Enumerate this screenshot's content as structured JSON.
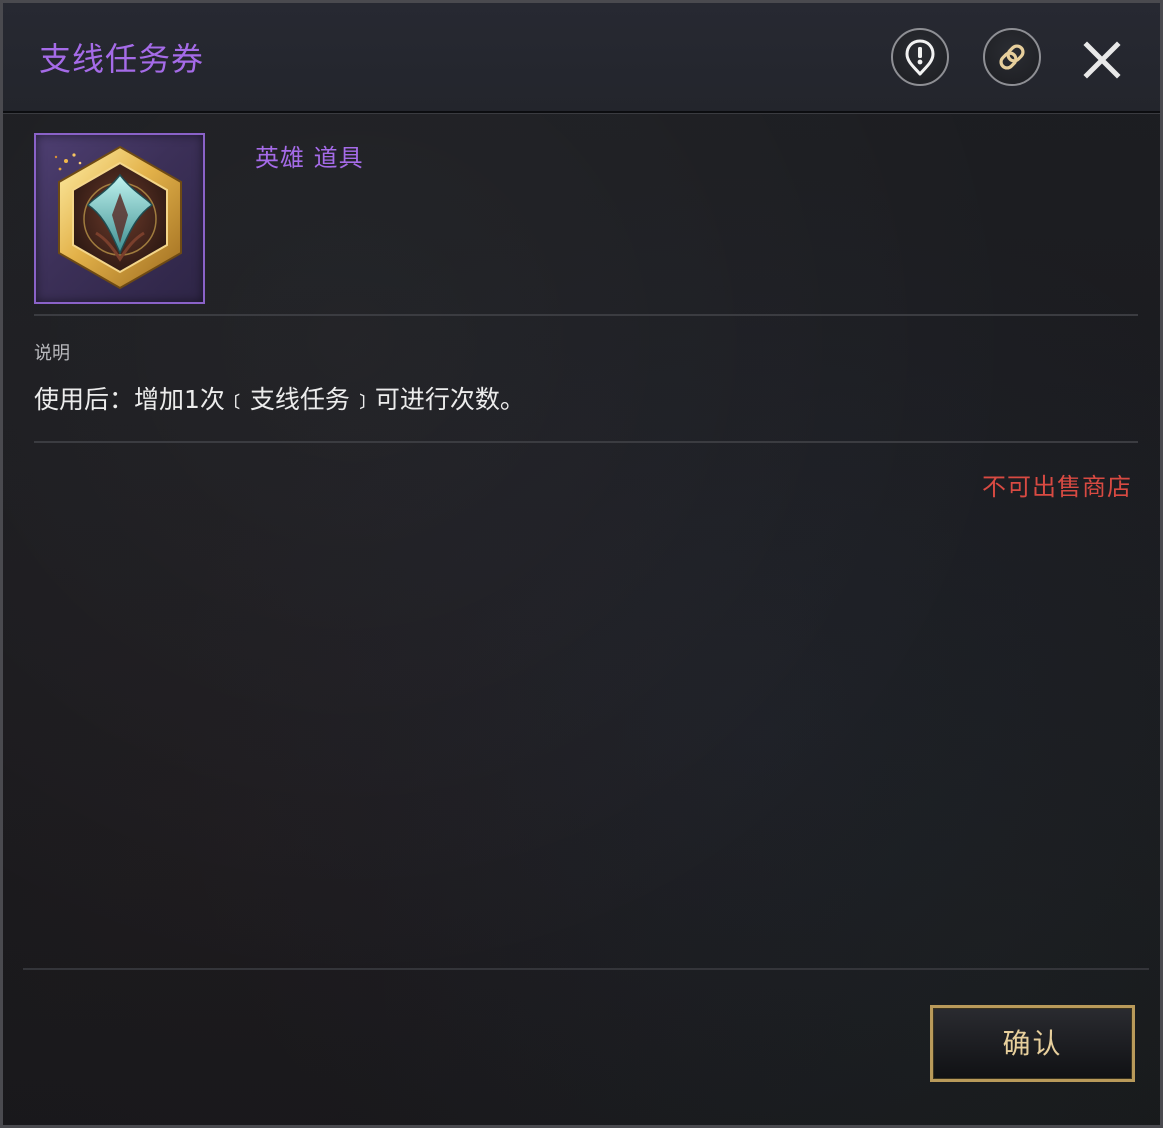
{
  "header": {
    "title": "支线任务券",
    "buttons": {
      "alert_icon": "alert-pin-icon",
      "link_icon": "link-icon",
      "close_icon": "close-icon"
    }
  },
  "item": {
    "icon": "quest-ticket-icon",
    "type_label": "英雄 道具"
  },
  "description": {
    "label": "说明",
    "text": "使用后：增加1次﹝支线任务﹞可进行次数。"
  },
  "sell_note": "不可出售商店",
  "footer": {
    "confirm_label": "确认"
  },
  "colors": {
    "title_purple": "#a56be8",
    "warning_red": "#d84a42",
    "button_gold": "#b99a5a"
  }
}
